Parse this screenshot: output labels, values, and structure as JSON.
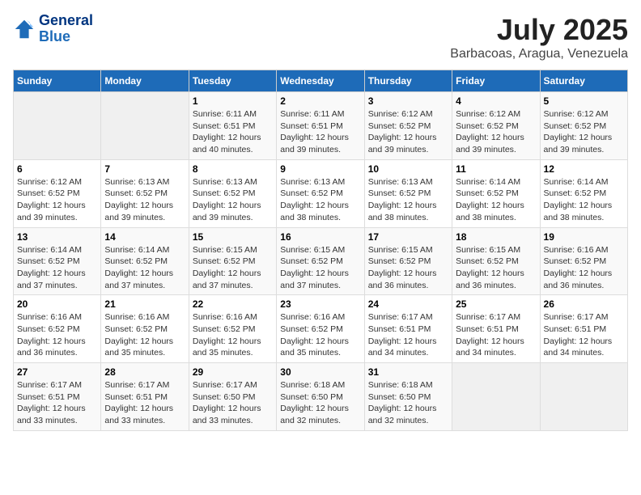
{
  "header": {
    "logo_line1": "General",
    "logo_line2": "Blue",
    "month_title": "July 2025",
    "location": "Barbacoas, Aragua, Venezuela"
  },
  "days_of_week": [
    "Sunday",
    "Monday",
    "Tuesday",
    "Wednesday",
    "Thursday",
    "Friday",
    "Saturday"
  ],
  "weeks": [
    [
      {
        "day": "",
        "info": ""
      },
      {
        "day": "",
        "info": ""
      },
      {
        "day": "1",
        "info": "Sunrise: 6:11 AM\nSunset: 6:51 PM\nDaylight: 12 hours and 40 minutes."
      },
      {
        "day": "2",
        "info": "Sunrise: 6:11 AM\nSunset: 6:51 PM\nDaylight: 12 hours and 39 minutes."
      },
      {
        "day": "3",
        "info": "Sunrise: 6:12 AM\nSunset: 6:52 PM\nDaylight: 12 hours and 39 minutes."
      },
      {
        "day": "4",
        "info": "Sunrise: 6:12 AM\nSunset: 6:52 PM\nDaylight: 12 hours and 39 minutes."
      },
      {
        "day": "5",
        "info": "Sunrise: 6:12 AM\nSunset: 6:52 PM\nDaylight: 12 hours and 39 minutes."
      }
    ],
    [
      {
        "day": "6",
        "info": "Sunrise: 6:12 AM\nSunset: 6:52 PM\nDaylight: 12 hours and 39 minutes."
      },
      {
        "day": "7",
        "info": "Sunrise: 6:13 AM\nSunset: 6:52 PM\nDaylight: 12 hours and 39 minutes."
      },
      {
        "day": "8",
        "info": "Sunrise: 6:13 AM\nSunset: 6:52 PM\nDaylight: 12 hours and 39 minutes."
      },
      {
        "day": "9",
        "info": "Sunrise: 6:13 AM\nSunset: 6:52 PM\nDaylight: 12 hours and 38 minutes."
      },
      {
        "day": "10",
        "info": "Sunrise: 6:13 AM\nSunset: 6:52 PM\nDaylight: 12 hours and 38 minutes."
      },
      {
        "day": "11",
        "info": "Sunrise: 6:14 AM\nSunset: 6:52 PM\nDaylight: 12 hours and 38 minutes."
      },
      {
        "day": "12",
        "info": "Sunrise: 6:14 AM\nSunset: 6:52 PM\nDaylight: 12 hours and 38 minutes."
      }
    ],
    [
      {
        "day": "13",
        "info": "Sunrise: 6:14 AM\nSunset: 6:52 PM\nDaylight: 12 hours and 37 minutes."
      },
      {
        "day": "14",
        "info": "Sunrise: 6:14 AM\nSunset: 6:52 PM\nDaylight: 12 hours and 37 minutes."
      },
      {
        "day": "15",
        "info": "Sunrise: 6:15 AM\nSunset: 6:52 PM\nDaylight: 12 hours and 37 minutes."
      },
      {
        "day": "16",
        "info": "Sunrise: 6:15 AM\nSunset: 6:52 PM\nDaylight: 12 hours and 37 minutes."
      },
      {
        "day": "17",
        "info": "Sunrise: 6:15 AM\nSunset: 6:52 PM\nDaylight: 12 hours and 36 minutes."
      },
      {
        "day": "18",
        "info": "Sunrise: 6:15 AM\nSunset: 6:52 PM\nDaylight: 12 hours and 36 minutes."
      },
      {
        "day": "19",
        "info": "Sunrise: 6:16 AM\nSunset: 6:52 PM\nDaylight: 12 hours and 36 minutes."
      }
    ],
    [
      {
        "day": "20",
        "info": "Sunrise: 6:16 AM\nSunset: 6:52 PM\nDaylight: 12 hours and 36 minutes."
      },
      {
        "day": "21",
        "info": "Sunrise: 6:16 AM\nSunset: 6:52 PM\nDaylight: 12 hours and 35 minutes."
      },
      {
        "day": "22",
        "info": "Sunrise: 6:16 AM\nSunset: 6:52 PM\nDaylight: 12 hours and 35 minutes."
      },
      {
        "day": "23",
        "info": "Sunrise: 6:16 AM\nSunset: 6:52 PM\nDaylight: 12 hours and 35 minutes."
      },
      {
        "day": "24",
        "info": "Sunrise: 6:17 AM\nSunset: 6:51 PM\nDaylight: 12 hours and 34 minutes."
      },
      {
        "day": "25",
        "info": "Sunrise: 6:17 AM\nSunset: 6:51 PM\nDaylight: 12 hours and 34 minutes."
      },
      {
        "day": "26",
        "info": "Sunrise: 6:17 AM\nSunset: 6:51 PM\nDaylight: 12 hours and 34 minutes."
      }
    ],
    [
      {
        "day": "27",
        "info": "Sunrise: 6:17 AM\nSunset: 6:51 PM\nDaylight: 12 hours and 33 minutes."
      },
      {
        "day": "28",
        "info": "Sunrise: 6:17 AM\nSunset: 6:51 PM\nDaylight: 12 hours and 33 minutes."
      },
      {
        "day": "29",
        "info": "Sunrise: 6:17 AM\nSunset: 6:50 PM\nDaylight: 12 hours and 33 minutes."
      },
      {
        "day": "30",
        "info": "Sunrise: 6:18 AM\nSunset: 6:50 PM\nDaylight: 12 hours and 32 minutes."
      },
      {
        "day": "31",
        "info": "Sunrise: 6:18 AM\nSunset: 6:50 PM\nDaylight: 12 hours and 32 minutes."
      },
      {
        "day": "",
        "info": ""
      },
      {
        "day": "",
        "info": ""
      }
    ]
  ]
}
